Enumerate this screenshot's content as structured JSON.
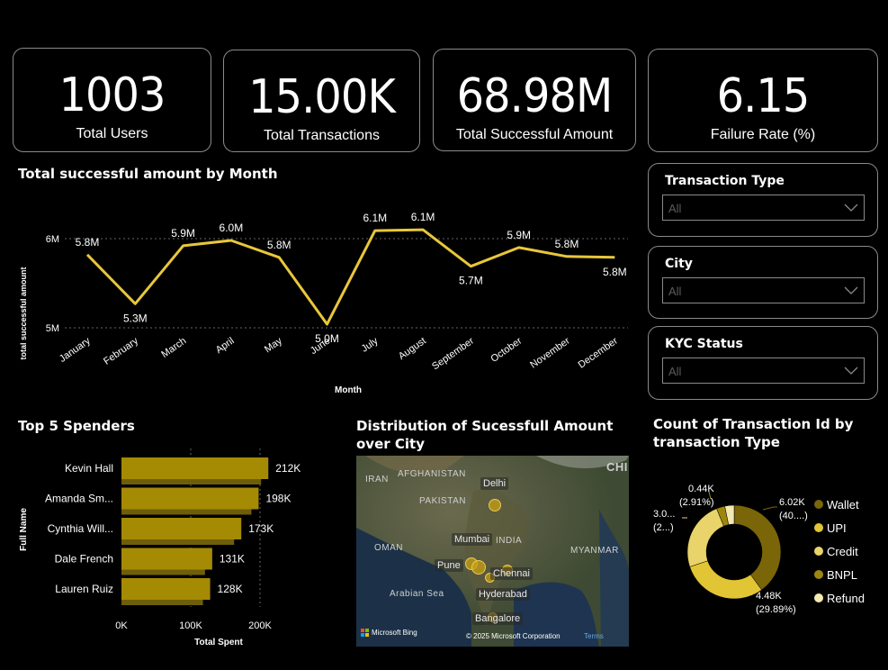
{
  "kpis": [
    {
      "value": "1003",
      "label": "Total Users"
    },
    {
      "value": "15.00K",
      "label": "Total Transactions"
    },
    {
      "value": "68.98M",
      "label": "Total Successful Amount"
    },
    {
      "value": "6.15",
      "label": "Failure Rate (%)"
    }
  ],
  "line_chart": {
    "title": "Total successful amount by Month",
    "ylabel": "total successful amount",
    "xlabel": "Month",
    "y_ticks": [
      "6M",
      "5M"
    ]
  },
  "bar_chart": {
    "title": "Top 5 Spenders",
    "ylabel": "Full Name",
    "xlabel": "Total Spent",
    "x_ticks": [
      "0K",
      "100K",
      "200K"
    ]
  },
  "map": {
    "title": "Distribution of Sucessfull Amount over City",
    "countries": [
      "IRAN",
      "AFGHANISTAN",
      "PAKISTAN",
      "INDIA",
      "OMAN",
      "MYANMAR",
      "CHI",
      "Arabian Sea"
    ],
    "cities": [
      "Delhi",
      "Mumbai",
      "Pune",
      "Chennai",
      "Hyderabad",
      "Bangalore"
    ],
    "attribution": "© 2025 Microsoft Corporation",
    "terms": "Terms",
    "logo": "Microsoft Bing"
  },
  "donut": {
    "title": "Count of Transaction Id by transaction Type",
    "labels": [
      {
        "line1": "6.02K",
        "line2": "(40....)"
      },
      {
        "line1": "4.48K",
        "line2": "(29.89%)"
      },
      {
        "line1": "3.0...",
        "line2": "(2...)"
      },
      {
        "line1": "0.44K",
        "line2": "(2.91%)"
      }
    ]
  },
  "slicers": [
    {
      "title": "Transaction Type",
      "placeholder": "All"
    },
    {
      "title": "City",
      "placeholder": "All"
    },
    {
      "title": "KYC Status",
      "placeholder": "All"
    }
  ],
  "colors": {
    "line": "#e8c73a",
    "bar": "#a58a04",
    "bar_shadow": "#6e5e0a",
    "wallet": "#7a6608",
    "upi": "#e2c534",
    "credit": "#e8d46a",
    "bnpl": "#9c860c",
    "refund": "#f3e9b2"
  },
  "chart_data": [
    {
      "type": "line",
      "title": "Total successful amount by Month",
      "xlabel": "Month",
      "ylabel": "total successful amount",
      "categories": [
        "January",
        "February",
        "March",
        "April",
        "May",
        "June",
        "July",
        "August",
        "September",
        "October",
        "November",
        "December"
      ],
      "values": [
        5.82,
        5.27,
        5.92,
        5.98,
        5.79,
        5.04,
        6.09,
        6.1,
        5.69,
        5.9,
        5.8,
        5.79
      ],
      "data_labels": [
        "5.8M",
        "5.3M",
        "5.9M",
        "6.0M",
        "5.8M",
        "5.0M",
        "6.1M",
        "6.1M",
        "5.7M",
        "5.9M",
        "5.8M",
        "5.8M"
      ],
      "ylim": [
        5.0,
        6.0
      ],
      "grid": true
    },
    {
      "type": "bar",
      "orientation": "horizontal",
      "title": "Top 5 Spenders",
      "xlabel": "Total Spent",
      "ylabel": "Full Name",
      "categories": [
        "Kevin Hall",
        "Amanda Sm...",
        "Cynthia Will...",
        "Dale French",
        "Lauren Ruiz"
      ],
      "values": [
        212,
        198,
        173,
        131,
        128
      ],
      "data_labels": [
        "212K",
        "198K",
        "173K",
        "131K",
        "128K"
      ],
      "xlim": [
        0,
        200
      ]
    },
    {
      "type": "pie",
      "variant": "donut",
      "title": "Count of Transaction Id by transaction Type",
      "categories": [
        "Wallet",
        "UPI",
        "Credit",
        "BNPL",
        "Refund"
      ],
      "values": [
        40.0,
        29.89,
        24.0,
        2.91,
        3.2
      ]
    }
  ]
}
